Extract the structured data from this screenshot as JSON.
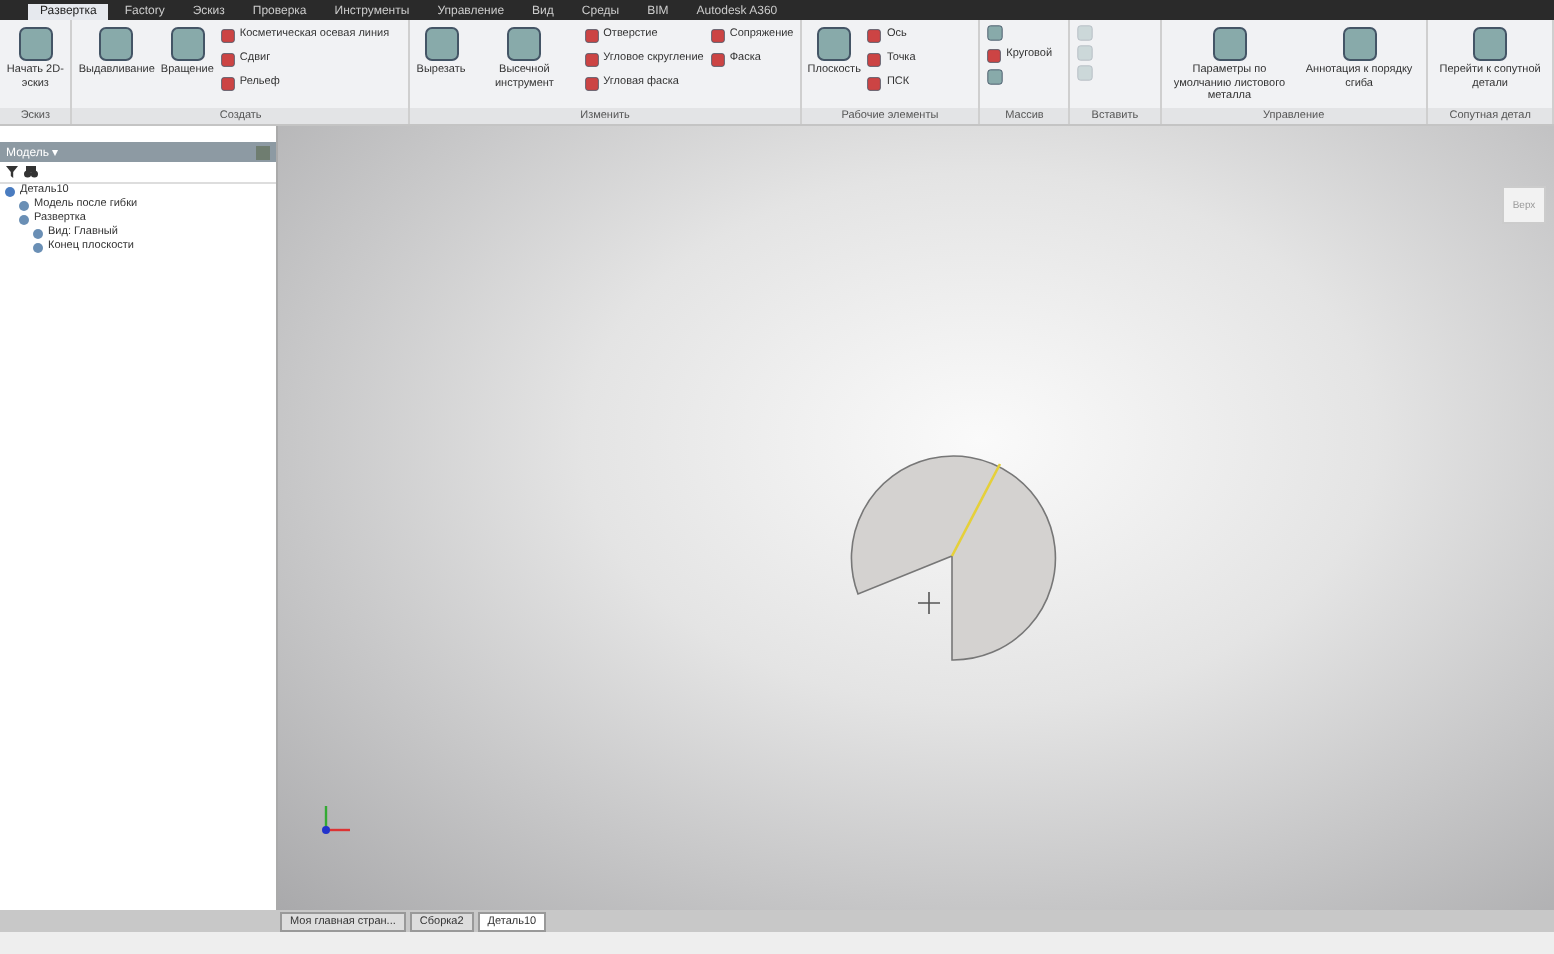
{
  "ribbon": {
    "tabs": [
      {
        "label": "Развертка",
        "selected": true
      },
      {
        "label": "Factory",
        "selected": false
      },
      {
        "label": "Эскиз",
        "selected": false
      },
      {
        "label": "Проверка",
        "selected": false
      },
      {
        "label": "Инструменты",
        "selected": false
      },
      {
        "label": "Управление",
        "selected": false
      },
      {
        "label": "Вид",
        "selected": false
      },
      {
        "label": "Среды",
        "selected": false
      },
      {
        "label": "BIM",
        "selected": false
      },
      {
        "label": "Autodesk A360",
        "selected": false
      }
    ],
    "groups": [
      {
        "label": "Эскиз",
        "columns": [
          [
            {
              "kind": "large",
              "label": "Начать 2D-эскиз",
              "disabled": false
            }
          ]
        ]
      },
      {
        "label": "Создать",
        "columns": [
          [
            {
              "kind": "large",
              "label": "Выдавливание",
              "disabled": false
            }
          ],
          [
            {
              "kind": "large",
              "label": "Вращение",
              "disabled": false
            }
          ],
          [
            {
              "kind": "small",
              "label": "Косметическая осевая линия",
              "disabled": false
            },
            {
              "kind": "small",
              "label": "Сдвиг",
              "disabled": false
            },
            {
              "kind": "small",
              "label": "Рельеф",
              "disabled": false
            }
          ]
        ]
      },
      {
        "label": "Изменить",
        "columns": [
          [
            {
              "kind": "large",
              "label": "Вырезать",
              "disabled": false
            }
          ],
          [
            {
              "kind": "large",
              "label": "Высечной инструмент",
              "disabled": false
            }
          ],
          [
            {
              "kind": "small",
              "label": "Отверстие",
              "disabled": false
            },
            {
              "kind": "small",
              "label": "Угловое скругление",
              "disabled": false
            },
            {
              "kind": "small",
              "label": "Угловая фаска",
              "disabled": false
            }
          ],
          [
            {
              "kind": "small",
              "label": "Сопряжение",
              "disabled": false
            },
            {
              "kind": "small",
              "label": "Фаска",
              "disabled": false
            }
          ]
        ]
      },
      {
        "label": "Рабочие элементы",
        "columns": [
          [
            {
              "kind": "large",
              "label": "Плоскость",
              "disabled": false
            }
          ],
          [
            {
              "kind": "small",
              "label": "Ось",
              "disabled": false
            },
            {
              "kind": "small",
              "label": "Точка",
              "disabled": false
            },
            {
              "kind": "small",
              "label": "ПСК",
              "disabled": false
            }
          ]
        ]
      },
      {
        "label": "Массив",
        "columns": [
          [
            {
              "kind": "icon",
              "disabled": false
            },
            {
              "kind": "small",
              "label": "Круговой",
              "disabled": false
            },
            {
              "kind": "icon",
              "disabled": false
            }
          ]
        ]
      },
      {
        "label": "Вставить",
        "columns": [
          [
            {
              "kind": "icon",
              "disabled": true
            },
            {
              "kind": "icon",
              "disabled": true
            },
            {
              "kind": "icon",
              "disabled": true
            }
          ]
        ]
      },
      {
        "label": "Управление",
        "columns": [
          [
            {
              "kind": "large",
              "label": "Параметры по умолчанию листового металла",
              "disabled": false
            }
          ],
          [
            {
              "kind": "large",
              "label": "Аннотация к порядку сгиба",
              "disabled": false
            }
          ]
        ]
      },
      {
        "label": "Сопутная детал",
        "columns": [
          [
            {
              "kind": "large",
              "label": "Перейти к сопутной детали",
              "disabled": false
            }
          ]
        ]
      }
    ]
  },
  "browser": {
    "title": "Модель ▾",
    "tree": [
      {
        "label": "Деталь10",
        "children": [
          {
            "label": "Модель после гибки"
          },
          {
            "label": "Развертка",
            "children": [
              {
                "label": "Вид: Главный"
              },
              {
                "label": "Конец плоскости"
              }
            ]
          }
        ]
      }
    ]
  },
  "viewport": {
    "viewcube_label": "Верх"
  },
  "document_tabs": [
    {
      "label": "Моя главная стран...",
      "selected": false
    },
    {
      "label": "Сборка2",
      "selected": false
    },
    {
      "label": "Деталь10",
      "selected": true
    }
  ]
}
